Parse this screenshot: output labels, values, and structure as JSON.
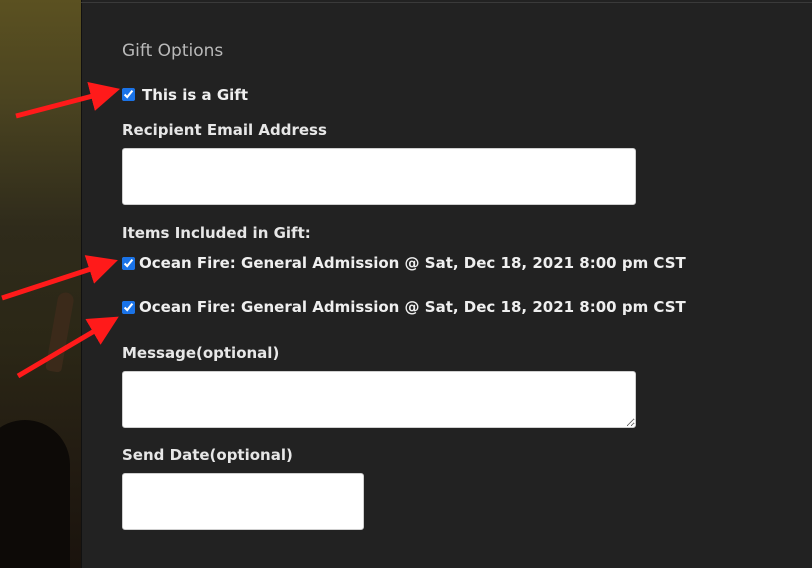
{
  "gift_options": {
    "title": "Gift Options",
    "is_gift_label": "This is a Gift",
    "is_gift_checked": true,
    "recipient_email_label": "Recipient Email Address",
    "recipient_email_value": "",
    "items_label": "Items Included in Gift:",
    "items": [
      {
        "label": "Ocean Fire: General Admission @ Sat, Dec 18, 2021 8:00 pm CST",
        "checked": true
      },
      {
        "label": "Ocean Fire: General Admission @ Sat, Dec 18, 2021 8:00 pm CST",
        "checked": true
      }
    ],
    "message_label": "Message(optional)",
    "message_value": "",
    "send_date_label": "Send Date(optional)",
    "send_date_value": ""
  },
  "annotation_color": "#ff1a1a"
}
